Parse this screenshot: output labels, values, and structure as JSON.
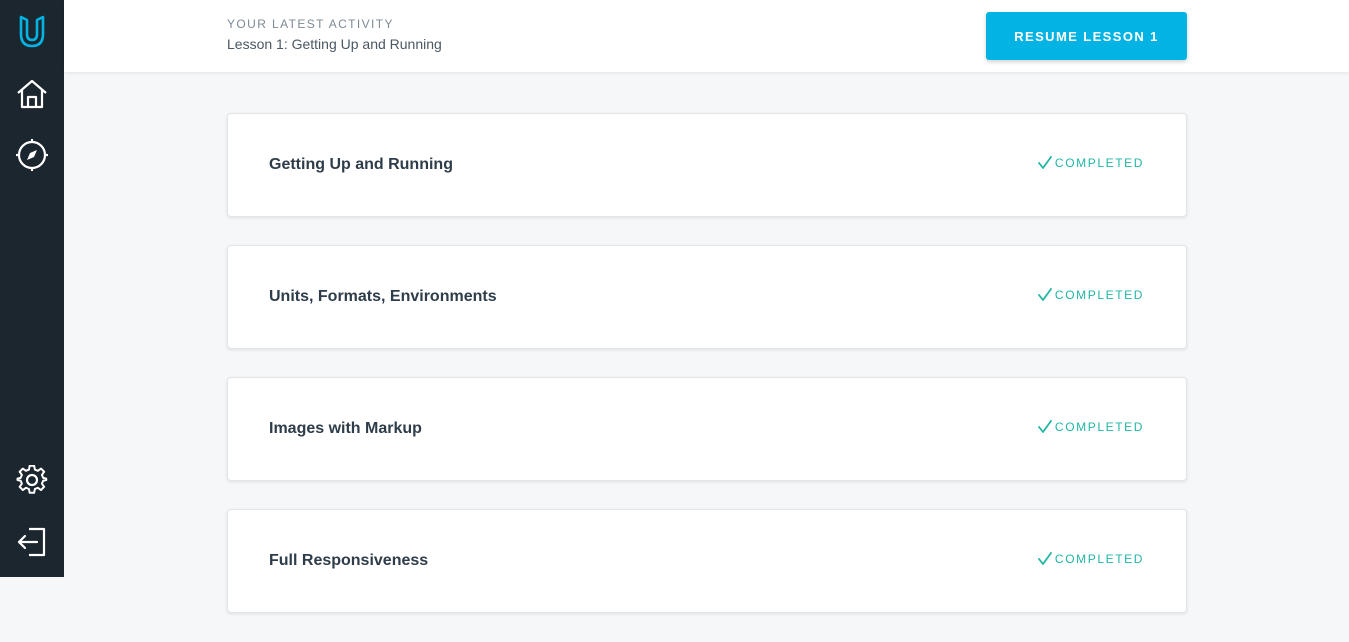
{
  "sidebar": {
    "items": [
      {
        "name": "udacity-logo-icon"
      },
      {
        "name": "home-icon"
      },
      {
        "name": "compass-icon"
      },
      {
        "name": "gear-icon"
      },
      {
        "name": "logout-icon"
      }
    ],
    "background": "#1c262f",
    "accent": "#02b3e4"
  },
  "header": {
    "activity_label": "YOUR LATEST ACTIVITY",
    "activity_title": "Lesson 1: Getting Up and Running",
    "resume_label": "RESUME LESSON 1",
    "accent": "#02b3e4"
  },
  "lessons": [
    {
      "title": "Getting Up and Running",
      "status": "COMPLETED"
    },
    {
      "title": "Units, Formats, Environments",
      "status": "COMPLETED"
    },
    {
      "title": "Images with Markup",
      "status": "COMPLETED"
    },
    {
      "title": "Full Responsiveness",
      "status": "COMPLETED"
    }
  ],
  "status_color": "#1fb6a3"
}
